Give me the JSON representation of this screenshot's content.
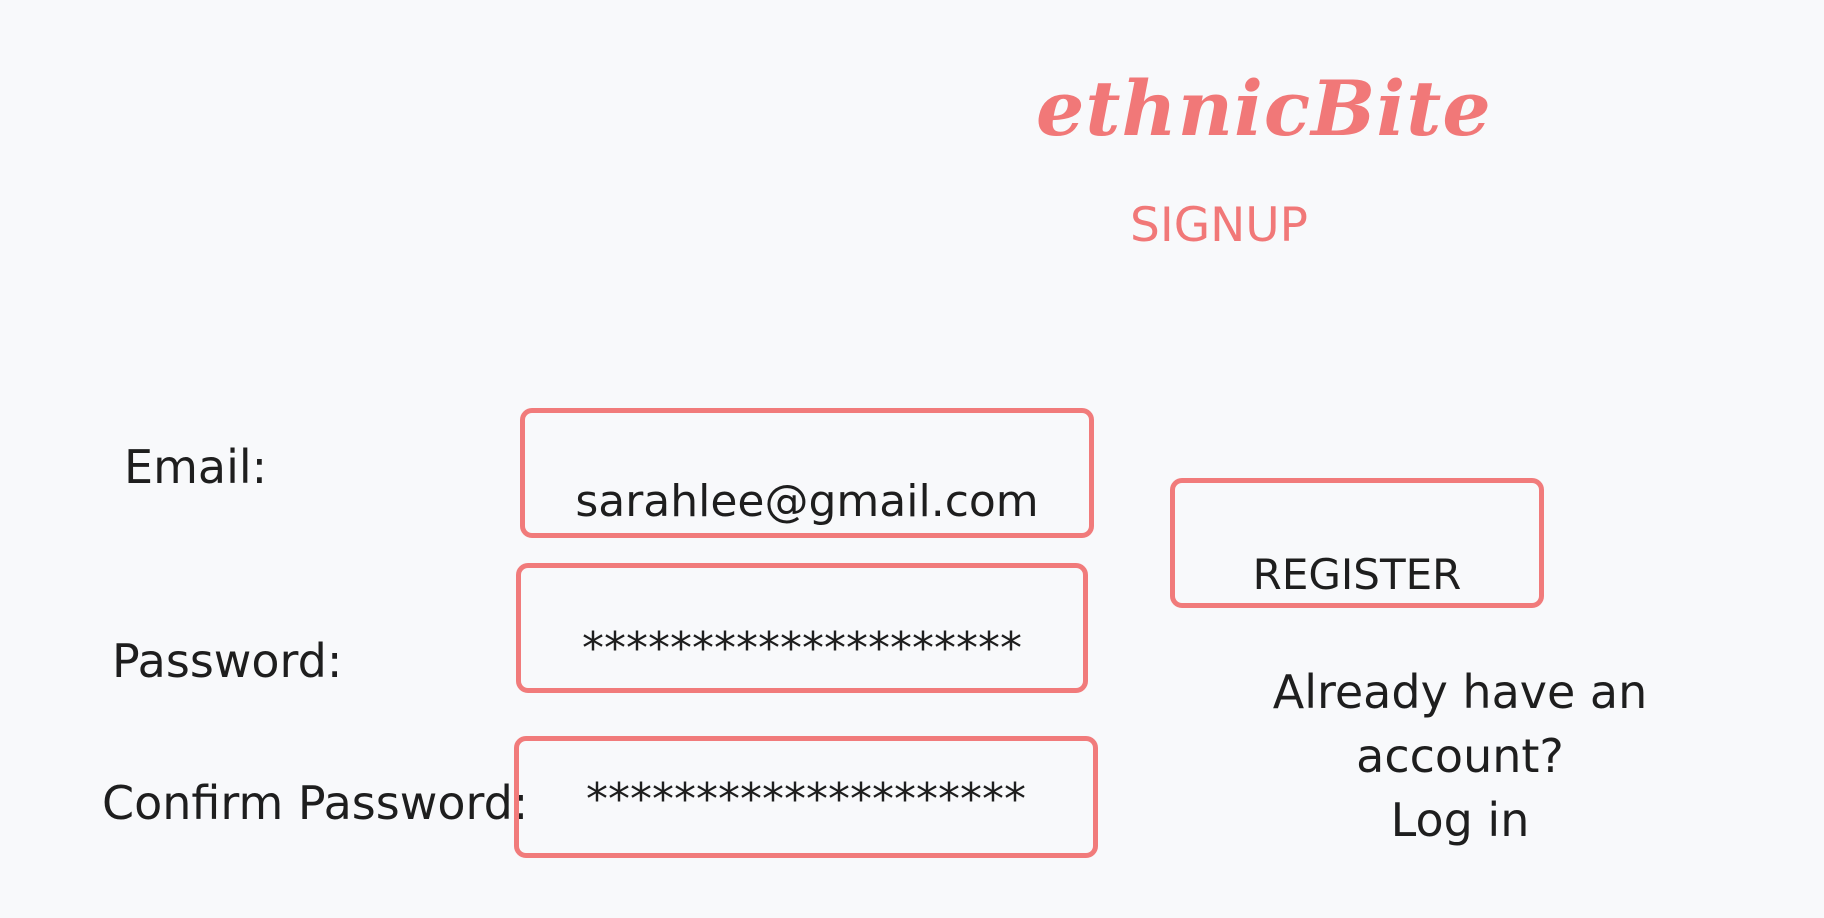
{
  "brand": {
    "logo_text": "ethnicBite",
    "page_heading": "SIGNUP",
    "accent_color": "#f17878"
  },
  "form": {
    "email_label": "Email:",
    "email_value": "sarahlee@gmail.com",
    "password_label": "Password:",
    "password_value": "********************",
    "confirm_label": "Confirm Password:",
    "confirm_value": "********************"
  },
  "actions": {
    "register_label": "REGISTER",
    "login_prompt": "Already have an account?",
    "login_link": "Log in"
  }
}
